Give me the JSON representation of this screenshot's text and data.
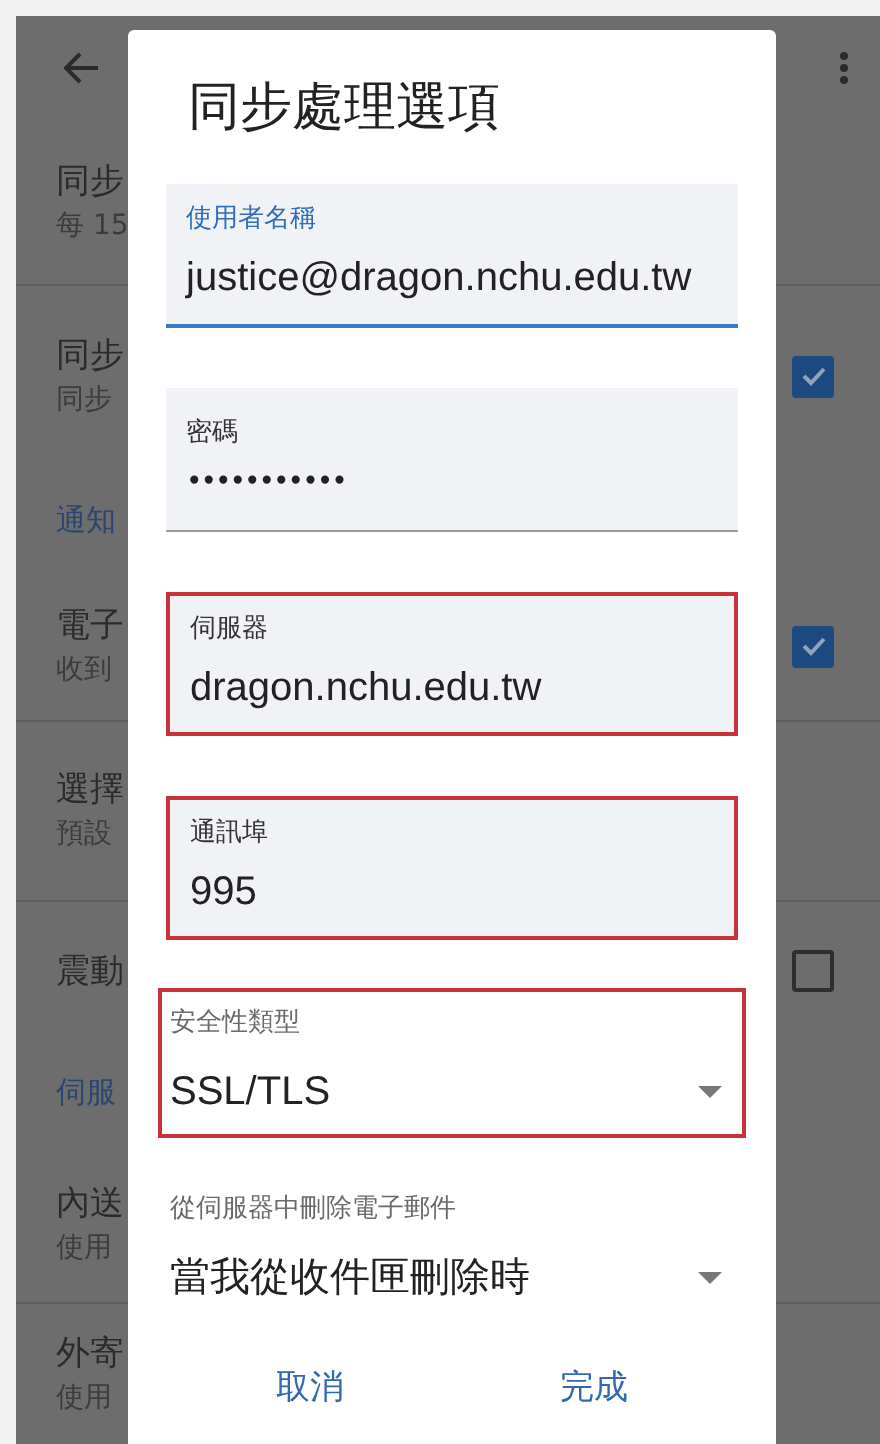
{
  "background": {
    "rows": [
      {
        "kind": "row",
        "title": "同步",
        "subtitle": "每 15"
      },
      {
        "kind": "check_row",
        "title": "同步",
        "subtitle": "同步",
        "checked": true
      },
      {
        "kind": "section",
        "title": "通知"
      },
      {
        "kind": "check_row",
        "title": "電子",
        "subtitle": "收到",
        "checked": true
      },
      {
        "kind": "row",
        "title": "選擇",
        "subtitle": "預設"
      },
      {
        "kind": "check_row",
        "title": "震動",
        "checked": false
      },
      {
        "kind": "section",
        "title": "伺服"
      },
      {
        "kind": "row",
        "title": "內送",
        "subtitle": "使用"
      },
      {
        "kind": "row",
        "title": "外寄",
        "subtitle": "使用"
      }
    ]
  },
  "dialog": {
    "title": "同步處理選項",
    "fields": [
      {
        "kind": "text",
        "label": "使用者名稱",
        "value": "justice@dragon.nchu.edu.tw",
        "focused": true,
        "highlighted": false
      },
      {
        "kind": "password",
        "label": "密碼",
        "value": "•••••••••••",
        "focused": false,
        "highlighted": false
      },
      {
        "kind": "text",
        "label": "伺服器",
        "value": "dragon.nchu.edu.tw",
        "focused": false,
        "highlighted": true
      },
      {
        "kind": "text",
        "label": "通訊埠",
        "value": "995",
        "focused": false,
        "highlighted": true
      },
      {
        "kind": "select",
        "label": "安全性類型",
        "value": "SSL/TLS",
        "highlighted": true
      },
      {
        "kind": "select",
        "label": "從伺服器中刪除電子郵件",
        "value": "當我從收件匣刪除時",
        "highlighted": false
      }
    ],
    "buttons": [
      "取消",
      "完成"
    ]
  }
}
